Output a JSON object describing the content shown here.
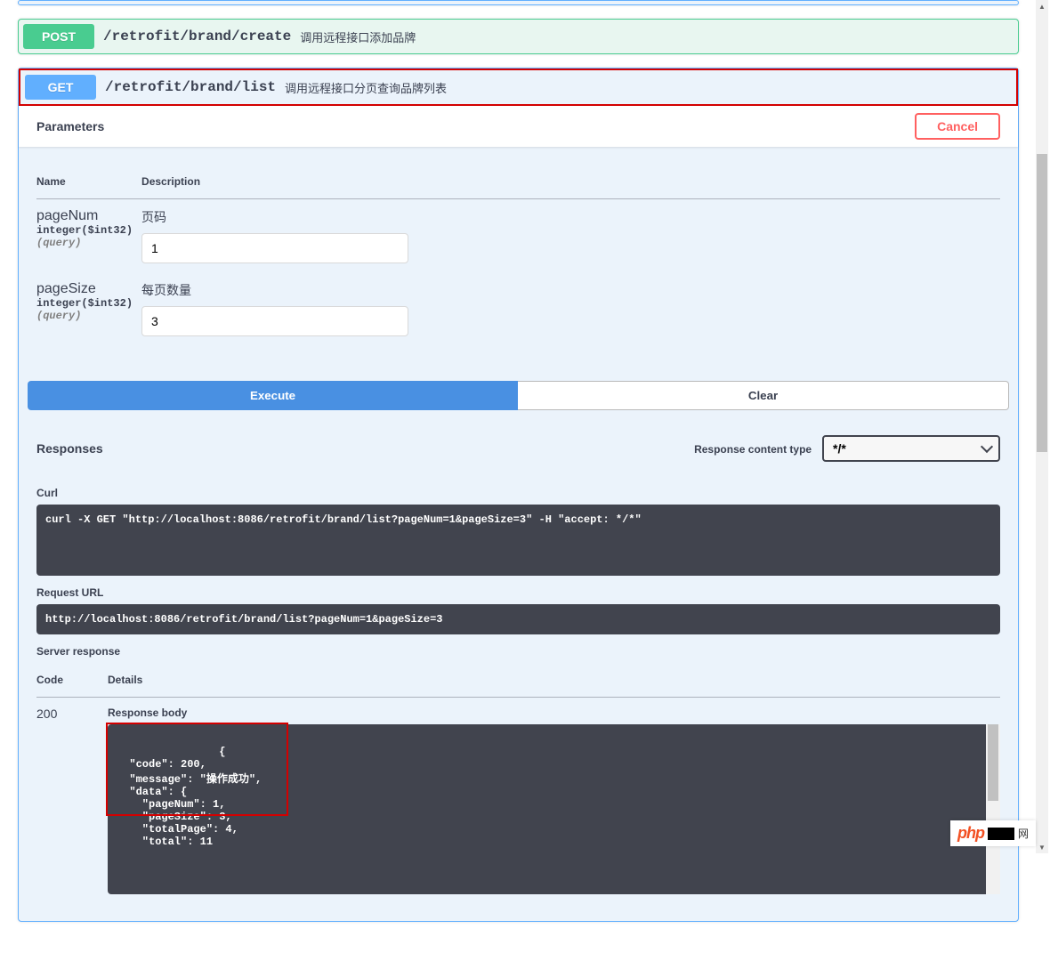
{
  "endpoints": {
    "post_create": {
      "method": "POST",
      "path": "/retrofit/brand/create",
      "desc": "调用远程接口添加品牌"
    },
    "get_list": {
      "method": "GET",
      "path": "/retrofit/brand/list",
      "desc": "调用远程接口分页查询品牌列表"
    }
  },
  "labels": {
    "parameters": "Parameters",
    "cancel": "Cancel",
    "name": "Name",
    "description": "Description",
    "execute": "Execute",
    "clear": "Clear",
    "responses": "Responses",
    "response_content_type": "Response content type",
    "content_type_value": "*/*",
    "curl": "Curl",
    "request_url": "Request URL",
    "server_response": "Server response",
    "code": "Code",
    "details": "Details",
    "response_body": "Response body"
  },
  "params": [
    {
      "name": "pageNum",
      "type": "integer($int32)",
      "in": "(query)",
      "desc": "页码",
      "value": "1"
    },
    {
      "name": "pageSize",
      "type": "integer($int32)",
      "in": "(query)",
      "desc": "每页数量",
      "value": "3"
    }
  ],
  "curl_cmd": "curl -X GET \"http://localhost:8086/retrofit/brand/list?pageNum=1&pageSize=3\" -H \"accept: */*\"",
  "request_url": "http://localhost:8086/retrofit/brand/list?pageNum=1&pageSize=3",
  "response": {
    "code": "200",
    "body": "{\n  \"code\": 200,\n  \"message\": \"操作成功\",\n  \"data\": {\n    \"pageNum\": 1,\n    \"pageSize\": 3,\n    \"totalPage\": 4,\n    \"total\": 11"
  },
  "watermark": {
    "php": "php",
    "suffix": "网"
  }
}
